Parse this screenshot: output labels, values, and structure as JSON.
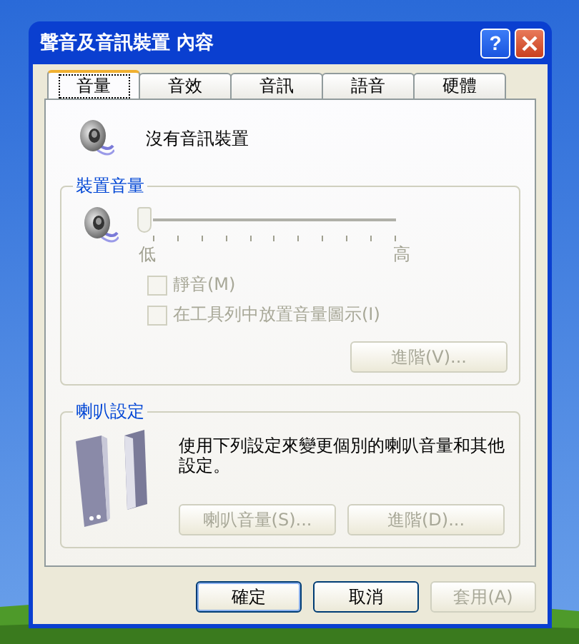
{
  "window": {
    "title": "聲音及音訊裝置 內容",
    "help": "?"
  },
  "tabs": [
    {
      "label": "音量",
      "selected": true
    },
    {
      "label": "音效",
      "selected": false
    },
    {
      "label": "音訊",
      "selected": false
    },
    {
      "label": "語音",
      "selected": false
    },
    {
      "label": "硬體",
      "selected": false
    }
  ],
  "device_status": "沒有音訊裝置",
  "device_volume": {
    "title": "裝置音量",
    "slider": {
      "level": 0,
      "min_label": "低",
      "max_label": "高",
      "disabled": true
    },
    "checkboxes": [
      {
        "label": "靜音(M)",
        "checked": false,
        "disabled": true
      },
      {
        "label": "在工具列中放置音量圖示(I)",
        "checked": false,
        "disabled": true
      }
    ],
    "advanced_button": {
      "label": "進階(V)...",
      "disabled": true
    }
  },
  "speaker_settings": {
    "title": "喇叭設定",
    "description": "使用下列設定來變更個別的喇叭音量和其他設定。",
    "buttons": [
      {
        "label": "喇叭音量(S)...",
        "disabled": true
      },
      {
        "label": "進階(D)...",
        "disabled": true
      }
    ]
  },
  "buttons": [
    {
      "label": "確定",
      "disabled": false,
      "default": true
    },
    {
      "label": "取消",
      "disabled": false,
      "default": false
    },
    {
      "label": "套用(A)",
      "disabled": true,
      "default": false
    }
  ]
}
